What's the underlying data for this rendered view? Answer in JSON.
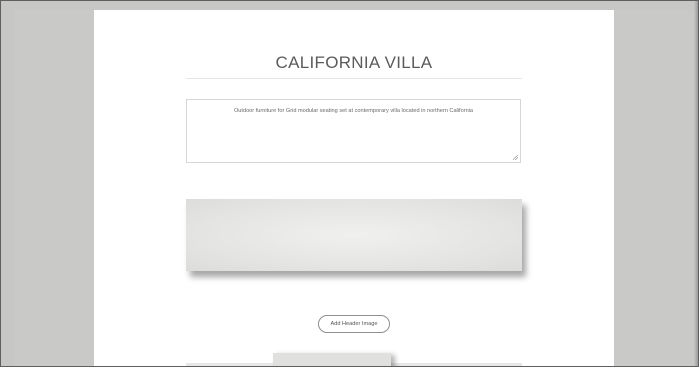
{
  "project": {
    "title": "CALIFORNIA VILLA",
    "description": "Outdoor furniture for Grid modular seating set at contemporary villa located in northern California"
  },
  "actions": {
    "add_header_image_label": "Add Header Image"
  }
}
